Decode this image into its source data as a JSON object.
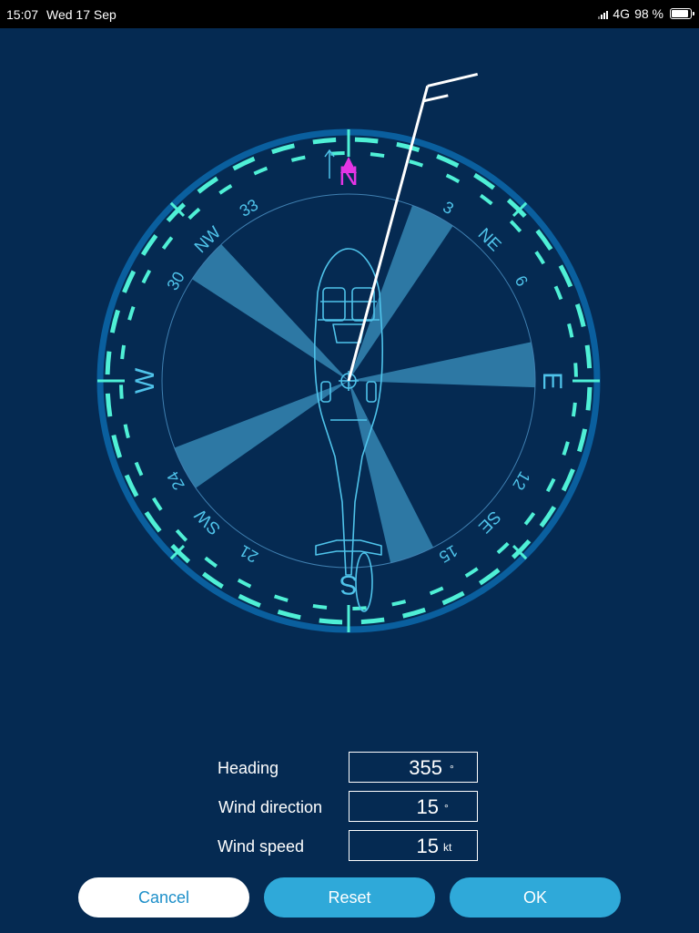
{
  "status_bar": {
    "time": "15:07",
    "date": "Wed 17 Sep",
    "network": "4G",
    "battery": "98 %",
    "battery_level": 0.98
  },
  "compass": {
    "cardinals": [
      "N",
      "E",
      "S",
      "W"
    ],
    "intercardinals": [
      "NE",
      "SE",
      "SW",
      "NW"
    ],
    "degree_labels": [
      "3",
      "6",
      "12",
      "15",
      "21",
      "24",
      "30",
      "33"
    ],
    "heading_deg": 355,
    "wind_direction_deg": 15,
    "wind_speed_kt": 15,
    "colors": {
      "background": "#052a52",
      "ring_outer": "#0a5f9e",
      "ring_accent": "#4ff0d6",
      "north_marker": "#e535e5",
      "beam": "#4fb8e8",
      "wind_indicator": "#ffffff"
    },
    "icons": {
      "aircraft": "helicopter-top-view-icon",
      "north": "north-triangle-icon",
      "wind": "wind-barb-icon"
    }
  },
  "form": {
    "heading": {
      "label": "Heading",
      "value": "355",
      "unit": "°"
    },
    "wind_direction": {
      "label": "Wind direction",
      "value": "15",
      "unit": "°"
    },
    "wind_speed": {
      "label": "Wind speed",
      "value": "15",
      "unit": "kt"
    }
  },
  "buttons": {
    "cancel": "Cancel",
    "reset": "Reset",
    "ok": "OK"
  }
}
